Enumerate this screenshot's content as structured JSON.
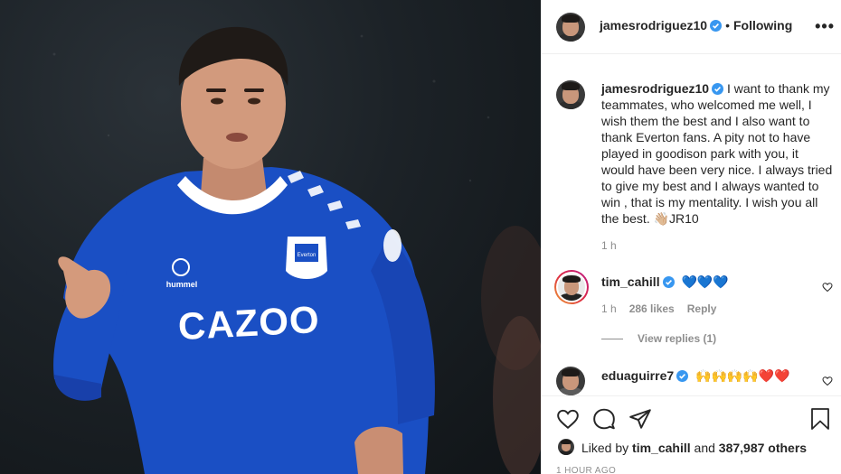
{
  "post": {
    "username": "jamesrodriguez10",
    "follow_status": "Following",
    "dot": "•",
    "more": "•••"
  },
  "caption": {
    "username": "jamesrodriguez10",
    "text": "I want to thank my teammates, who welcomed me well, I wish them the best and I also want to thank Everton fans. A pity not to have played in goodison park with you, it would have been very nice. I always tried to give my best and I always wanted to win , that is my mentality. I wish you all the best. 👋🏼JR10",
    "time": "1 h"
  },
  "comments": [
    {
      "username": "tim_cahill",
      "text": "💙💙💙",
      "time": "1 h",
      "likes": "286 likes",
      "reply_label": "Reply",
      "view_replies": "View replies (1)"
    },
    {
      "username": "eduaguirre7",
      "text": "🙌🙌🙌🙌❤️❤️"
    }
  ],
  "likes": {
    "prefix": "Liked by",
    "user": "tim_cahill",
    "and": "and",
    "count": "387,987 others"
  },
  "time_ago": "1 HOUR AGO",
  "photo": {
    "shirt_sponsor": "CAZOO",
    "kit_brand": "hummel",
    "crest_text": "Everton"
  },
  "colors": {
    "verified": "#3897f0",
    "kit_blue": "#1a4fc4",
    "text_secondary": "#8e8e8e"
  }
}
